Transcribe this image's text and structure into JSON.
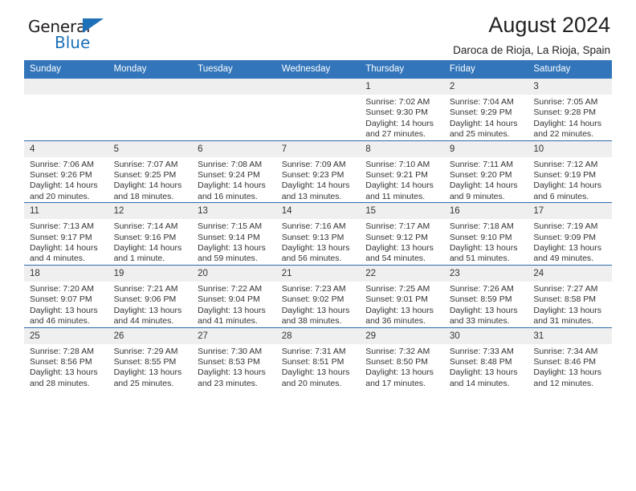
{
  "brand": {
    "name_part1": "General",
    "name_part2": "Blue",
    "accent_color": "#1d71b8"
  },
  "header": {
    "title": "August 2024",
    "location": "Daroca de Rioja, La Rioja, Spain"
  },
  "theme": {
    "header_bar_color": "#3275ba",
    "row_divider_color": "#2d6ca8",
    "daynum_band_color": "#efefef",
    "text_color": "#333333"
  },
  "weekday_headers": [
    "Sunday",
    "Monday",
    "Tuesday",
    "Wednesday",
    "Thursday",
    "Friday",
    "Saturday"
  ],
  "labels": {
    "sunrise_prefix": "Sunrise:",
    "sunset_prefix": "Sunset:",
    "daylight_prefix": "Daylight:"
  },
  "weeks": [
    [
      {
        "day": "",
        "sunrise": "",
        "sunset": "",
        "daylight_line1": "",
        "daylight_line2": "",
        "empty": true
      },
      {
        "day": "",
        "sunrise": "",
        "sunset": "",
        "daylight_line1": "",
        "daylight_line2": "",
        "empty": true
      },
      {
        "day": "",
        "sunrise": "",
        "sunset": "",
        "daylight_line1": "",
        "daylight_line2": "",
        "empty": true
      },
      {
        "day": "",
        "sunrise": "",
        "sunset": "",
        "daylight_line1": "",
        "daylight_line2": "",
        "empty": true
      },
      {
        "day": "1",
        "sunrise": "Sunrise: 7:02 AM",
        "sunset": "Sunset: 9:30 PM",
        "daylight_line1": "Daylight: 14 hours",
        "daylight_line2": "and 27 minutes.",
        "empty": false
      },
      {
        "day": "2",
        "sunrise": "Sunrise: 7:04 AM",
        "sunset": "Sunset: 9:29 PM",
        "daylight_line1": "Daylight: 14 hours",
        "daylight_line2": "and 25 minutes.",
        "empty": false
      },
      {
        "day": "3",
        "sunrise": "Sunrise: 7:05 AM",
        "sunset": "Sunset: 9:28 PM",
        "daylight_line1": "Daylight: 14 hours",
        "daylight_line2": "and 22 minutes.",
        "empty": false
      }
    ],
    [
      {
        "day": "4",
        "sunrise": "Sunrise: 7:06 AM",
        "sunset": "Sunset: 9:26 PM",
        "daylight_line1": "Daylight: 14 hours",
        "daylight_line2": "and 20 minutes.",
        "empty": false
      },
      {
        "day": "5",
        "sunrise": "Sunrise: 7:07 AM",
        "sunset": "Sunset: 9:25 PM",
        "daylight_line1": "Daylight: 14 hours",
        "daylight_line2": "and 18 minutes.",
        "empty": false
      },
      {
        "day": "6",
        "sunrise": "Sunrise: 7:08 AM",
        "sunset": "Sunset: 9:24 PM",
        "daylight_line1": "Daylight: 14 hours",
        "daylight_line2": "and 16 minutes.",
        "empty": false
      },
      {
        "day": "7",
        "sunrise": "Sunrise: 7:09 AM",
        "sunset": "Sunset: 9:23 PM",
        "daylight_line1": "Daylight: 14 hours",
        "daylight_line2": "and 13 minutes.",
        "empty": false
      },
      {
        "day": "8",
        "sunrise": "Sunrise: 7:10 AM",
        "sunset": "Sunset: 9:21 PM",
        "daylight_line1": "Daylight: 14 hours",
        "daylight_line2": "and 11 minutes.",
        "empty": false
      },
      {
        "day": "9",
        "sunrise": "Sunrise: 7:11 AM",
        "sunset": "Sunset: 9:20 PM",
        "daylight_line1": "Daylight: 14 hours",
        "daylight_line2": "and 9 minutes.",
        "empty": false
      },
      {
        "day": "10",
        "sunrise": "Sunrise: 7:12 AM",
        "sunset": "Sunset: 9:19 PM",
        "daylight_line1": "Daylight: 14 hours",
        "daylight_line2": "and 6 minutes.",
        "empty": false
      }
    ],
    [
      {
        "day": "11",
        "sunrise": "Sunrise: 7:13 AM",
        "sunset": "Sunset: 9:17 PM",
        "daylight_line1": "Daylight: 14 hours",
        "daylight_line2": "and 4 minutes.",
        "empty": false
      },
      {
        "day": "12",
        "sunrise": "Sunrise: 7:14 AM",
        "sunset": "Sunset: 9:16 PM",
        "daylight_line1": "Daylight: 14 hours",
        "daylight_line2": "and 1 minute.",
        "empty": false
      },
      {
        "day": "13",
        "sunrise": "Sunrise: 7:15 AM",
        "sunset": "Sunset: 9:14 PM",
        "daylight_line1": "Daylight: 13 hours",
        "daylight_line2": "and 59 minutes.",
        "empty": false
      },
      {
        "day": "14",
        "sunrise": "Sunrise: 7:16 AM",
        "sunset": "Sunset: 9:13 PM",
        "daylight_line1": "Daylight: 13 hours",
        "daylight_line2": "and 56 minutes.",
        "empty": false
      },
      {
        "day": "15",
        "sunrise": "Sunrise: 7:17 AM",
        "sunset": "Sunset: 9:12 PM",
        "daylight_line1": "Daylight: 13 hours",
        "daylight_line2": "and 54 minutes.",
        "empty": false
      },
      {
        "day": "16",
        "sunrise": "Sunrise: 7:18 AM",
        "sunset": "Sunset: 9:10 PM",
        "daylight_line1": "Daylight: 13 hours",
        "daylight_line2": "and 51 minutes.",
        "empty": false
      },
      {
        "day": "17",
        "sunrise": "Sunrise: 7:19 AM",
        "sunset": "Sunset: 9:09 PM",
        "daylight_line1": "Daylight: 13 hours",
        "daylight_line2": "and 49 minutes.",
        "empty": false
      }
    ],
    [
      {
        "day": "18",
        "sunrise": "Sunrise: 7:20 AM",
        "sunset": "Sunset: 9:07 PM",
        "daylight_line1": "Daylight: 13 hours",
        "daylight_line2": "and 46 minutes.",
        "empty": false
      },
      {
        "day": "19",
        "sunrise": "Sunrise: 7:21 AM",
        "sunset": "Sunset: 9:06 PM",
        "daylight_line1": "Daylight: 13 hours",
        "daylight_line2": "and 44 minutes.",
        "empty": false
      },
      {
        "day": "20",
        "sunrise": "Sunrise: 7:22 AM",
        "sunset": "Sunset: 9:04 PM",
        "daylight_line1": "Daylight: 13 hours",
        "daylight_line2": "and 41 minutes.",
        "empty": false
      },
      {
        "day": "21",
        "sunrise": "Sunrise: 7:23 AM",
        "sunset": "Sunset: 9:02 PM",
        "daylight_line1": "Daylight: 13 hours",
        "daylight_line2": "and 38 minutes.",
        "empty": false
      },
      {
        "day": "22",
        "sunrise": "Sunrise: 7:25 AM",
        "sunset": "Sunset: 9:01 PM",
        "daylight_line1": "Daylight: 13 hours",
        "daylight_line2": "and 36 minutes.",
        "empty": false
      },
      {
        "day": "23",
        "sunrise": "Sunrise: 7:26 AM",
        "sunset": "Sunset: 8:59 PM",
        "daylight_line1": "Daylight: 13 hours",
        "daylight_line2": "and 33 minutes.",
        "empty": false
      },
      {
        "day": "24",
        "sunrise": "Sunrise: 7:27 AM",
        "sunset": "Sunset: 8:58 PM",
        "daylight_line1": "Daylight: 13 hours",
        "daylight_line2": "and 31 minutes.",
        "empty": false
      }
    ],
    [
      {
        "day": "25",
        "sunrise": "Sunrise: 7:28 AM",
        "sunset": "Sunset: 8:56 PM",
        "daylight_line1": "Daylight: 13 hours",
        "daylight_line2": "and 28 minutes.",
        "empty": false
      },
      {
        "day": "26",
        "sunrise": "Sunrise: 7:29 AM",
        "sunset": "Sunset: 8:55 PM",
        "daylight_line1": "Daylight: 13 hours",
        "daylight_line2": "and 25 minutes.",
        "empty": false
      },
      {
        "day": "27",
        "sunrise": "Sunrise: 7:30 AM",
        "sunset": "Sunset: 8:53 PM",
        "daylight_line1": "Daylight: 13 hours",
        "daylight_line2": "and 23 minutes.",
        "empty": false
      },
      {
        "day": "28",
        "sunrise": "Sunrise: 7:31 AM",
        "sunset": "Sunset: 8:51 PM",
        "daylight_line1": "Daylight: 13 hours",
        "daylight_line2": "and 20 minutes.",
        "empty": false
      },
      {
        "day": "29",
        "sunrise": "Sunrise: 7:32 AM",
        "sunset": "Sunset: 8:50 PM",
        "daylight_line1": "Daylight: 13 hours",
        "daylight_line2": "and 17 minutes.",
        "empty": false
      },
      {
        "day": "30",
        "sunrise": "Sunrise: 7:33 AM",
        "sunset": "Sunset: 8:48 PM",
        "daylight_line1": "Daylight: 13 hours",
        "daylight_line2": "and 14 minutes.",
        "empty": false
      },
      {
        "day": "31",
        "sunrise": "Sunrise: 7:34 AM",
        "sunset": "Sunset: 8:46 PM",
        "daylight_line1": "Daylight: 13 hours",
        "daylight_line2": "and 12 minutes.",
        "empty": false
      }
    ]
  ]
}
